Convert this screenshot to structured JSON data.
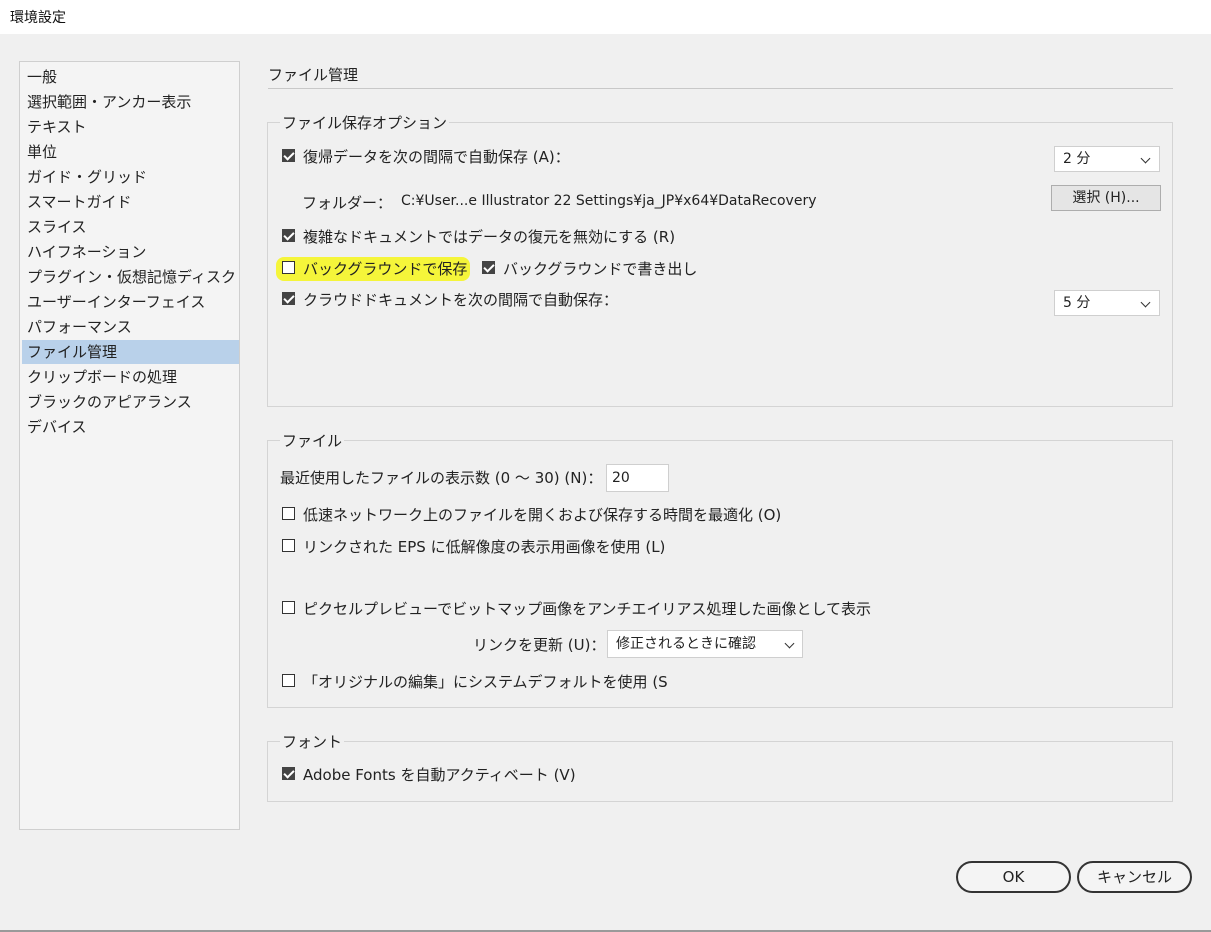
{
  "window": {
    "title": "環境設定"
  },
  "sidebar": {
    "items": [
      {
        "label": "一般"
      },
      {
        "label": "選択範囲・アンカー表示"
      },
      {
        "label": "テキスト"
      },
      {
        "label": "単位"
      },
      {
        "label": "ガイド・グリッド"
      },
      {
        "label": "スマートガイド"
      },
      {
        "label": "スライス"
      },
      {
        "label": "ハイフネーション"
      },
      {
        "label": "プラグイン・仮想記憶ディスク"
      },
      {
        "label": "ユーザーインターフェイス"
      },
      {
        "label": "パフォーマンス"
      },
      {
        "label": "ファイル管理"
      },
      {
        "label": "クリップボードの処理"
      },
      {
        "label": "ブラックのアピアランス"
      },
      {
        "label": "デバイス"
      }
    ],
    "selected_index": 11
  },
  "main": {
    "title": "ファイル管理",
    "save_options": {
      "label": "ファイル保存オプション",
      "autosave_label": "復帰データを次の間隔で自動保存 (A)：",
      "autosave_checked": true,
      "autosave_interval": "2 分",
      "folder_label": "フォルダー：",
      "folder_path": "C:¥User...e Illustrator 22 Settings¥ja_JP¥x64¥DataRecovery",
      "choose_button": "選択 (H)...",
      "disable_recovery_label": "複雑なドキュメントではデータの復元を無効にする (R)",
      "disable_recovery_checked": true,
      "background_save_label": "バックグラウンドで保存",
      "background_save_checked": false,
      "background_export_label": "バックグラウンドで書き出し",
      "background_export_checked": true,
      "cloud_autosave_label": "クラウドドキュメントを次の間隔で自動保存：",
      "cloud_autosave_checked": true,
      "cloud_interval": "5 分"
    },
    "files": {
      "label": "ファイル",
      "recent_count_label": "最近使用したファイルの表示数 (0 〜 30) (N)：",
      "recent_count_value": "20",
      "optimize_network_label": "低速ネットワーク上のファイルを開くおよび保存する時間を最適化 (O)",
      "optimize_network_checked": false,
      "low_res_eps_label": "リンクされた EPS に低解像度の表示用画像を使用 (L)",
      "low_res_eps_checked": false,
      "pixel_preview_label": "ピクセルプレビューでビットマップ画像をアンチエイリアス処理した画像として表示",
      "pixel_preview_checked": false,
      "update_links_label": "リンクを更新 (U)：",
      "update_links_value": "修正されるときに確認",
      "edit_original_label": "「オリジナルの編集」にシステムデフォルトを使用 (S",
      "edit_original_checked": false
    },
    "fonts": {
      "label": "フォント",
      "auto_activate_label": "Adobe Fonts を自動アクティベート (V)",
      "auto_activate_checked": true
    }
  },
  "footer": {
    "ok_label": "OK",
    "cancel_label": "キャンセル"
  },
  "colors": {
    "selection": "#b9d1ea",
    "highlight": "#f5f53a"
  }
}
